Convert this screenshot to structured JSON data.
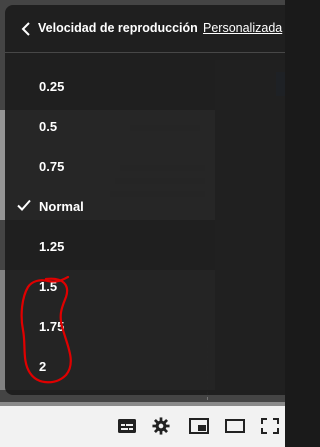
{
  "menu": {
    "title": "Velocidad de reproducción",
    "custom_label": "Personalizada",
    "selected": "Normal",
    "options": [
      {
        "label": "0.25"
      },
      {
        "label": "0.5"
      },
      {
        "label": "0.75"
      },
      {
        "label": "Normal"
      },
      {
        "label": "1.25"
      },
      {
        "label": "1.5"
      },
      {
        "label": "1.75"
      },
      {
        "label": "2"
      }
    ]
  },
  "annotation": {
    "color": "#e00000"
  },
  "controls": {
    "icons": [
      "subtitles-icon",
      "settings-icon",
      "miniplayer-icon",
      "theater-mode-icon",
      "fullscreen-icon"
    ]
  },
  "colors": {
    "menu_bg": "#1c1c1c",
    "text": "#ffffff",
    "controls_bg": "#f2f2f2"
  }
}
